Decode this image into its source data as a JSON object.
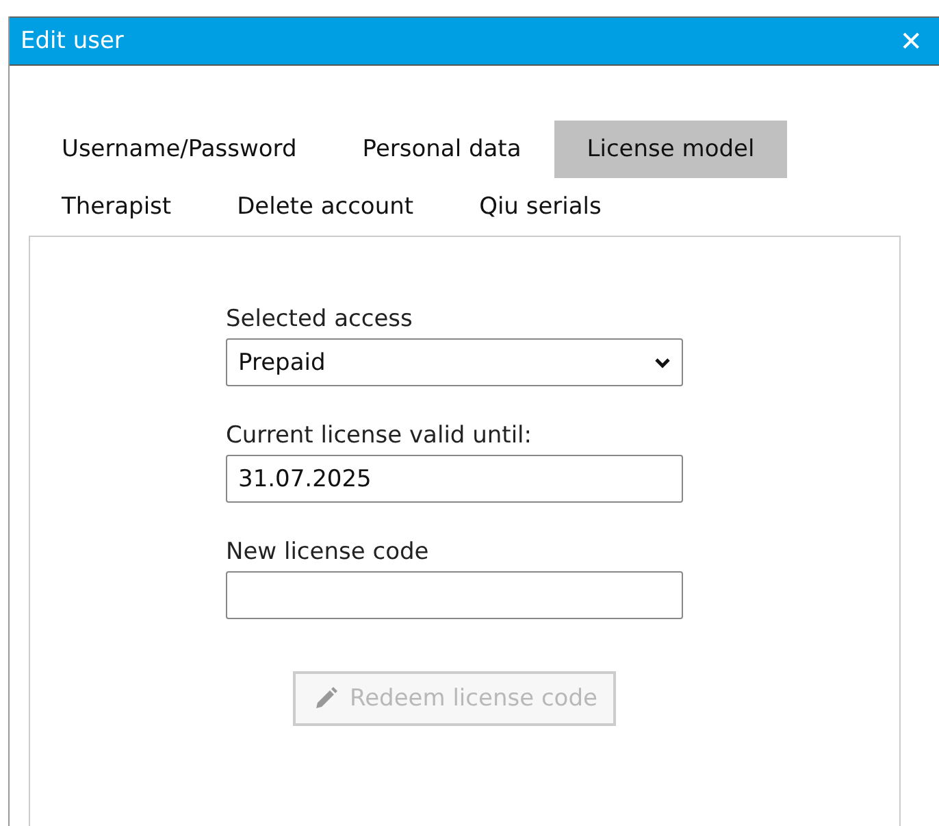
{
  "window": {
    "title": "Edit user",
    "close": "✕"
  },
  "tabs": [
    {
      "label": "Username/Password",
      "selected": false
    },
    {
      "label": "Personal data",
      "selected": false
    },
    {
      "label": "License model",
      "selected": true
    },
    {
      "label": "Therapist",
      "selected": false
    },
    {
      "label": "Delete account",
      "selected": false
    },
    {
      "label": "Qiu serials",
      "selected": false
    }
  ],
  "form": {
    "fields": [
      {
        "kind": "select",
        "label": "Selected access",
        "value": "Prepaid"
      },
      {
        "kind": "text",
        "label": "Current license valid until:",
        "value": "31.07.2025"
      },
      {
        "kind": "text",
        "label": "New license code"
      }
    ],
    "button": {
      "label": "Redeem license code",
      "disabled": true
    }
  }
}
